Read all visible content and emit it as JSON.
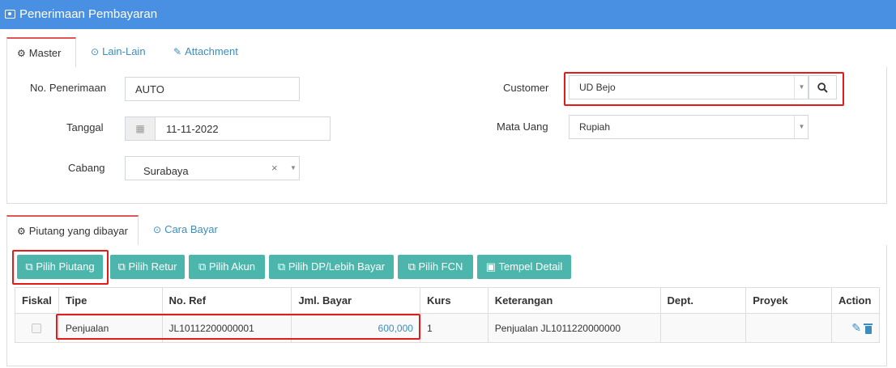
{
  "window": {
    "title": "Penerimaan Pembayaran",
    "title_icon": "money-icon"
  },
  "master_tabs": [
    {
      "label": "Master",
      "icon": "cogs-icon",
      "active": true
    },
    {
      "label": "Lain-Lain",
      "icon": "check-circle-icon",
      "active": false
    },
    {
      "label": "Attachment",
      "icon": "paperclip-icon",
      "active": false
    }
  ],
  "form": {
    "no_penerimaan": {
      "label": "No. Penerimaan",
      "value": "AUTO"
    },
    "tanggal": {
      "label": "Tanggal",
      "value": "11-11-2022",
      "icon": "calendar-icon"
    },
    "cabang": {
      "label": "Cabang",
      "value": "Surabaya",
      "clear": "×"
    },
    "customer": {
      "label": "Customer",
      "value": "UD Bejo",
      "search_icon": "search-icon"
    },
    "mata_uang": {
      "label": "Mata Uang",
      "value": "Rupiah"
    }
  },
  "detail_tabs": [
    {
      "label": "Piutang yang dibayar",
      "icon": "cogs-icon",
      "active": true
    },
    {
      "label": "Cara Bayar",
      "icon": "check-circle-icon",
      "active": false
    }
  ],
  "toolbar": {
    "pilih_piutang": "Pilih Piutang",
    "pilih_retur": "Pilih Retur",
    "pilih_akun": "Pilih Akun",
    "pilih_dp": "Pilih DP/Lebih Bayar",
    "pilih_fcn": "Pilih FCN",
    "tempel_detail": "Tempel Detail"
  },
  "table": {
    "columns": [
      "Fiskal",
      "Tipe",
      "No. Ref",
      "Jml. Bayar",
      "Kurs",
      "Keterangan",
      "Dept.",
      "Proyek",
      "Action"
    ],
    "rows": [
      {
        "fiskal": false,
        "tipe": "Penjualan",
        "no_ref": "JL10112200000001",
        "jml_bayar": "600,000",
        "kurs": "1",
        "keterangan": "Penjualan JL1011220000000",
        "dept": "",
        "proyek": ""
      }
    ]
  },
  "colors": {
    "header": "#4a90e2",
    "button": "#4db6ac",
    "highlight": "#e31b1b",
    "link": "#3c8dbc"
  }
}
